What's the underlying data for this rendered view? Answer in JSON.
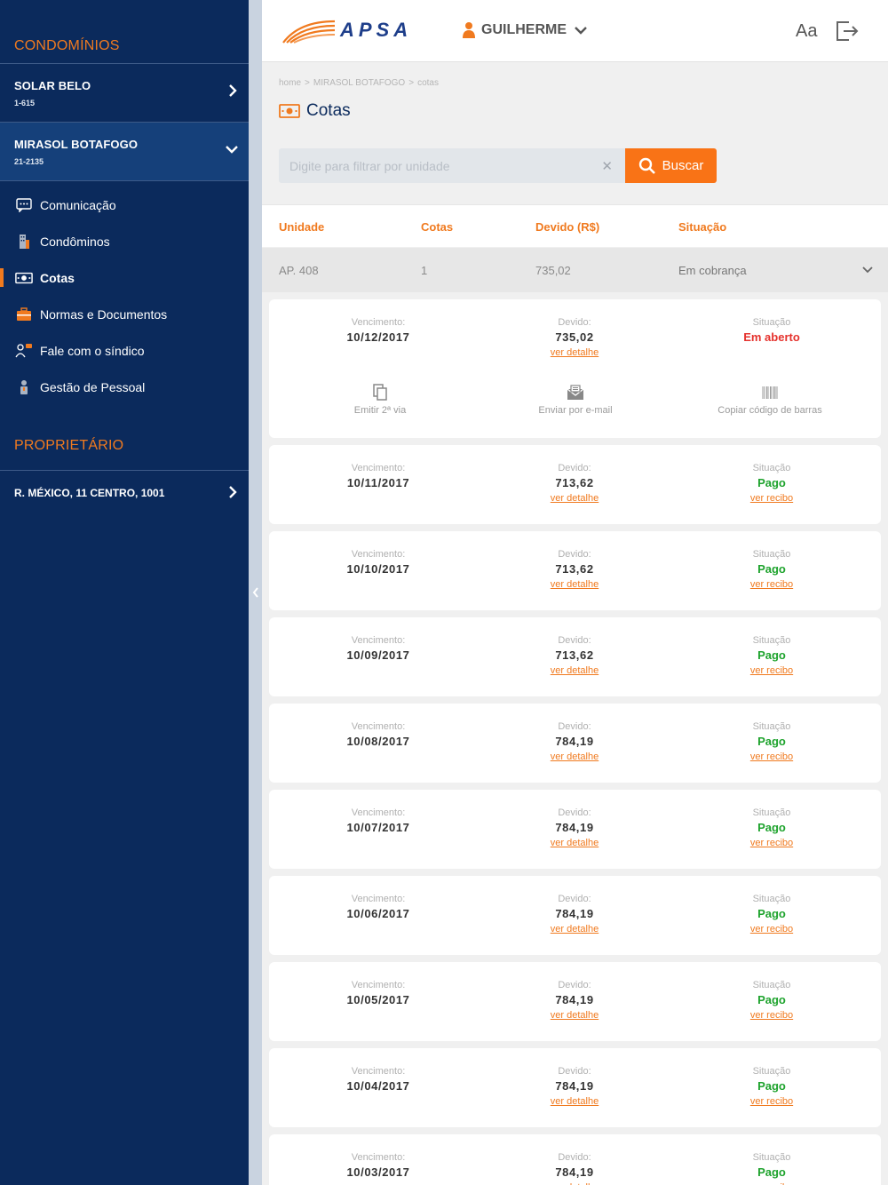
{
  "sidebar": {
    "section_condominios": "CONDOMÍNIOS",
    "condos": [
      {
        "name": "SOLAR BELO",
        "code": "1-615"
      },
      {
        "name": "MIRASOL BOTAFOGO",
        "code": "21-2135"
      }
    ],
    "menu": [
      {
        "label": "Comunicação",
        "icon": "chat-icon"
      },
      {
        "label": "Condôminos",
        "icon": "building-icon"
      },
      {
        "label": "Cotas",
        "icon": "money-icon"
      },
      {
        "label": "Normas e Documentos",
        "icon": "briefcase-icon"
      },
      {
        "label": "Fale com o síndico",
        "icon": "person-chat-icon"
      },
      {
        "label": "Gestão de Pessoal",
        "icon": "staff-icon"
      }
    ],
    "section_proprietario": "PROPRIETÁRIO",
    "owner_address": "R. MÉXICO, 11 CENTRO, 1001"
  },
  "header": {
    "logo_text": "APSA",
    "user_name": "GUILHERME",
    "font_toggle": "Aa"
  },
  "breadcrumb": [
    "home",
    "MIRASOL BOTAFOGO",
    "cotas"
  ],
  "page_title": "Cotas",
  "search": {
    "placeholder": "Digite para filtrar por unidade",
    "value": "",
    "button_label": "Buscar"
  },
  "table": {
    "headers": [
      "Unidade",
      "Cotas",
      "Devido (R$)",
      "Situação"
    ],
    "unit_row": {
      "unidade": "AP. 408",
      "cotas": "1",
      "devido": "735,02",
      "situacao": "Em cobrança"
    }
  },
  "labels": {
    "vencimento": "Vencimento:",
    "devido": "Devido:",
    "situacao": "Situação",
    "ver_detalhe": "ver detalhe",
    "ver_recibo": "ver recibo"
  },
  "actions": [
    {
      "label": "Emitir 2ª via",
      "icon": "copy-icon"
    },
    {
      "label": "Enviar por e-mail",
      "icon": "email-icon"
    },
    {
      "label": "Copiar código de barras",
      "icon": "barcode-icon"
    }
  ],
  "installments": [
    {
      "vencimento": "10/12/2017",
      "devido": "735,02",
      "situacao": "Em aberto"
    },
    {
      "vencimento": "10/11/2017",
      "devido": "713,62",
      "situacao": "Pago"
    },
    {
      "vencimento": "10/10/2017",
      "devido": "713,62",
      "situacao": "Pago"
    },
    {
      "vencimento": "10/09/2017",
      "devido": "713,62",
      "situacao": "Pago"
    },
    {
      "vencimento": "10/08/2017",
      "devido": "784,19",
      "situacao": "Pago"
    },
    {
      "vencimento": "10/07/2017",
      "devido": "784,19",
      "situacao": "Pago"
    },
    {
      "vencimento": "10/06/2017",
      "devido": "784,19",
      "situacao": "Pago"
    },
    {
      "vencimento": "10/05/2017",
      "devido": "784,19",
      "situacao": "Pago"
    },
    {
      "vencimento": "10/04/2017",
      "devido": "784,19",
      "situacao": "Pago"
    },
    {
      "vencimento": "10/03/2017",
      "devido": "784,19",
      "situacao": "Pago"
    }
  ],
  "colors": {
    "sidebar_bg": "#0b2a5c",
    "accent_orange": "#f97316",
    "status_open": "#e5322d",
    "status_paid": "#1ea32d"
  }
}
